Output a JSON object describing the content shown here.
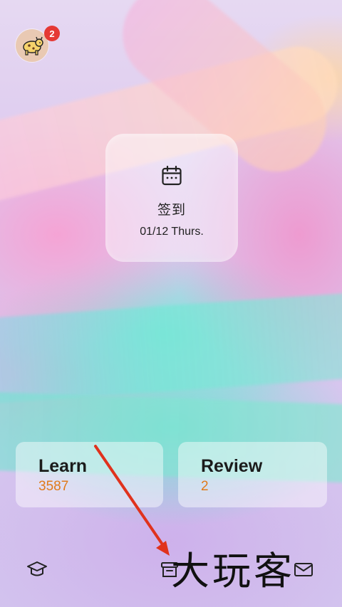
{
  "header": {
    "notification_count": "2"
  },
  "checkin": {
    "title": "签到",
    "date": "01/12 Thurs."
  },
  "cards": [
    {
      "label": "Learn",
      "count": "3587"
    },
    {
      "label": "Review",
      "count": "2"
    }
  ],
  "tabbar": {
    "items": [
      "graduation-cap-icon",
      "box-icon",
      "mail-icon"
    ]
  },
  "watermark": "大玩客",
  "colors": {
    "badge": "#e53935",
    "count_accent": "#e07a1a",
    "annotation_arrow": "#e0321d"
  }
}
